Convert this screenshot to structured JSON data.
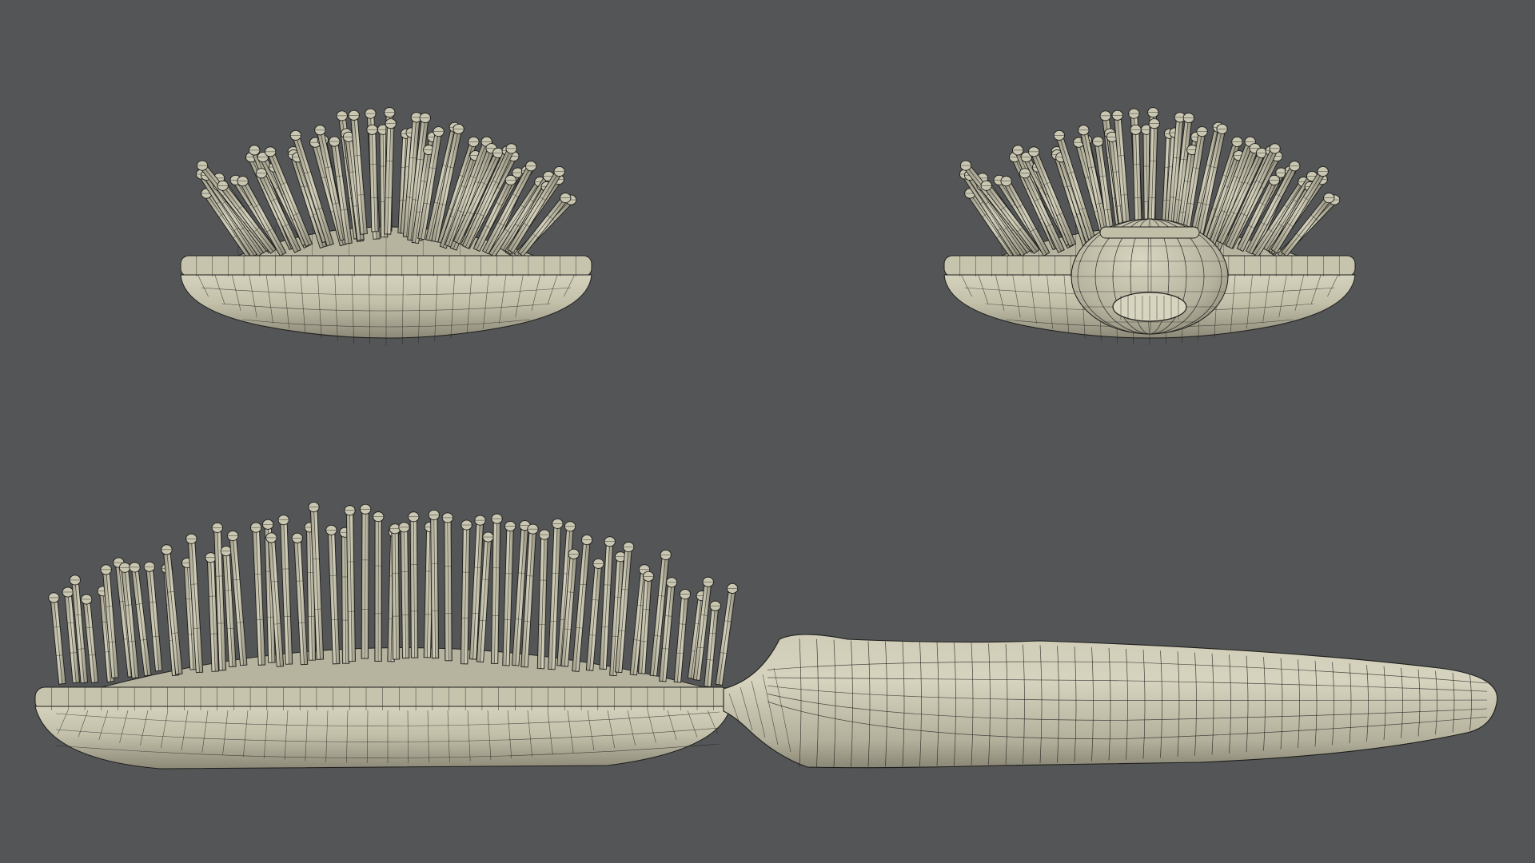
{
  "scene": {
    "background": "#545556",
    "mesh_fill": "#bfbca7",
    "mesh_fill_dark": "#8f8c7a",
    "wire_color": "#1e1e1c",
    "views": [
      {
        "id": "front-view",
        "subject": "hairbrush-front",
        "bristle_count": 60
      },
      {
        "id": "back-view",
        "subject": "hairbrush-back",
        "bristle_count": 60
      },
      {
        "id": "side-view",
        "subject": "hairbrush-side",
        "bristle_count": 62
      }
    ]
  }
}
